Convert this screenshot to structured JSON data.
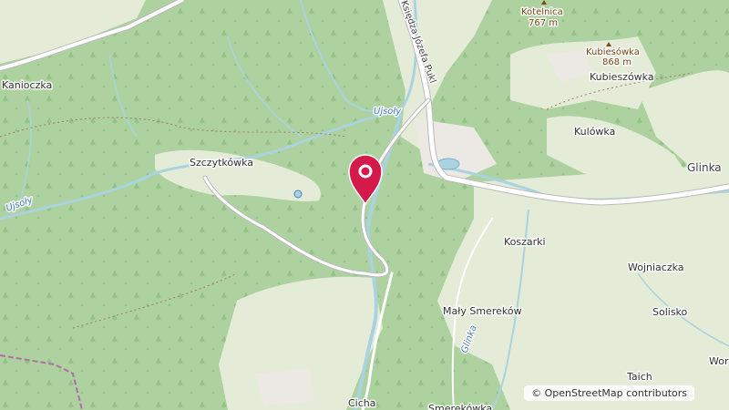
{
  "map": {
    "colors": {
      "forest": "#aed1a0",
      "meadow": "#e4ecd8",
      "settlement": "#f1f1ee",
      "water": "#aad3df",
      "road": "#ffffff",
      "road_casing": "#bbbbbb",
      "marker": "#d6194b",
      "border": "#b06fa9"
    },
    "labels": {
      "kanioczka": "Kanioczka",
      "szczytkowka": "Szczytkówka",
      "ujsoly_river": "Ujsoły",
      "ujsoly_west": "Ujsoły",
      "road_name": "Księdza Józefa Pukl",
      "kotelnica": "Kotelnica",
      "kotelnica_elev": "767 m",
      "kubiesowka_peak": "Kubiesówka",
      "kubiesowka_elev": "868 m",
      "kubieszowka": "Kubieszówka",
      "kulowka": "Kulówka",
      "glinka": "Glinka",
      "koszarki": "Koszarki",
      "maly_smerekow": "Mały Smereków",
      "glinka_stream": "Glinka",
      "wojniaczka": "Wojniaczka",
      "solisko": "Solisko",
      "taich": "Taich",
      "wor": "Wor",
      "cicha": "Cicha",
      "smerekowka": "Smereków­ka"
    },
    "marker": {
      "name": "selected-location",
      "icon": "map-pin-icon"
    },
    "attribution": "© OpenStreetMap contributors"
  }
}
